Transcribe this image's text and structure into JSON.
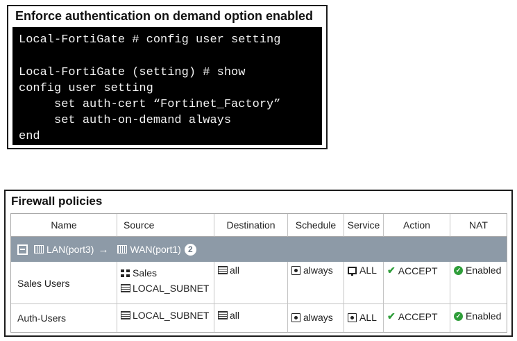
{
  "cli": {
    "title": "Enforce authentication on demand option enabled",
    "lines": [
      "Local-FortiGate # config user setting",
      "",
      "Local-FortiGate (setting) # show",
      "config user setting",
      "     set auth-cert “Fortinet_Factory”",
      "     set auth-on-demand always",
      "end"
    ]
  },
  "firewall": {
    "title": "Firewall policies",
    "columns": [
      "Name",
      "Source",
      "Destination",
      "Schedule",
      "Service",
      "Action",
      "NAT"
    ],
    "group": {
      "from": "LAN(port3)",
      "arrow": "→",
      "to": "WAN(port1)",
      "count": "2"
    },
    "rows": [
      {
        "name": "Sales Users",
        "source": [
          "Sales",
          "LOCAL_SUBNET"
        ],
        "destination": "all",
        "schedule": "always",
        "service": "ALL",
        "action": "ACCEPT",
        "nat": "Enabled"
      },
      {
        "name": "Auth-Users",
        "source": [
          "LOCAL_SUBNET"
        ],
        "destination": "all",
        "schedule": "always",
        "service": "ALL",
        "action": "ACCEPT",
        "nat": "Enabled"
      }
    ],
    "colors": {
      "group_bar": "#8d9aa7",
      "accept": "#2f9e3a"
    },
    "icons": {
      "collapse": "collapse-icon",
      "interface": "interface-icon",
      "address": "address-icon",
      "address_group": "address-group-icon",
      "schedule": "schedule-icon",
      "service": "service-icon",
      "accept": "check-icon",
      "nat": "check-circle-icon"
    }
  }
}
